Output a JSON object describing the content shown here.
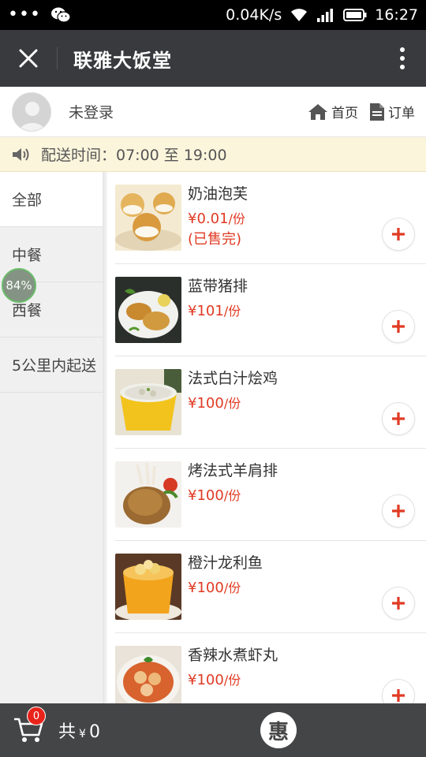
{
  "status_bar": {
    "dots": "•••",
    "speed": "0.04K/s",
    "time": "16:27"
  },
  "title_bar": {
    "title": "联雅大饭堂"
  },
  "user": {
    "login_status": "未登录",
    "home_label": "首页",
    "orders_label": "订单"
  },
  "notice": {
    "text": "配送时间：07:00 至 19:00"
  },
  "categories": [
    {
      "label": "全部",
      "active": true
    },
    {
      "label": "中餐",
      "active": false
    },
    {
      "label": "西餐",
      "active": false
    },
    {
      "label": "5公里内起送",
      "active": false
    }
  ],
  "progress_badge": "84%",
  "products": [
    {
      "name": "奶油泡芙",
      "currency": "¥",
      "price": "0.01",
      "unit": "/份",
      "status": "(已售完)"
    },
    {
      "name": "蓝带猪排",
      "currency": "¥",
      "price": "101",
      "unit": "/份",
      "status": ""
    },
    {
      "name": "法式白汁烩鸡",
      "currency": "¥",
      "price": "100",
      "unit": "/份",
      "status": ""
    },
    {
      "name": "烤法式羊肩排",
      "currency": "¥",
      "price": "100",
      "unit": "/份",
      "status": ""
    },
    {
      "name": "橙汁龙利鱼",
      "currency": "¥",
      "price": "100",
      "unit": "/份",
      "status": ""
    },
    {
      "name": "香辣水煮虾丸",
      "currency": "¥",
      "price": "100",
      "unit": "/份",
      "status": ""
    }
  ],
  "cart": {
    "count": "0",
    "total_prefix": "共",
    "currency": "¥",
    "total": "0",
    "discount_label": "惠"
  },
  "colors": {
    "title_bar": "#393a3e",
    "price_red": "#e03a23",
    "notice_bg": "#fbf5dc",
    "bottom_bar": "#444547",
    "badge_red": "#e8231a"
  }
}
